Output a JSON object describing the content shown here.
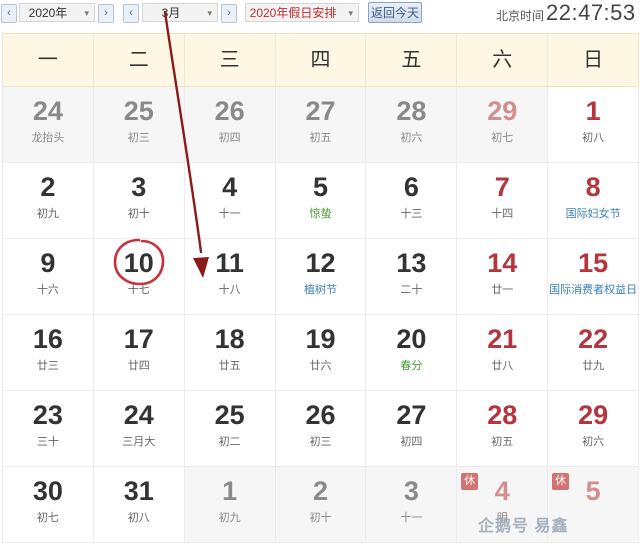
{
  "toolbar": {
    "year_value": "2020年",
    "month_value": "3月",
    "holiday_value": "2020年假日安排",
    "today_label": "返回今天",
    "clock_label": "北京时间",
    "clock_time": "22:47:53",
    "prev_glyph": "‹",
    "next_glyph": "›",
    "caret_glyph": "▾"
  },
  "weekdays": [
    "一",
    "二",
    "三",
    "四",
    "五",
    "六",
    "日"
  ],
  "rest_label": "休",
  "weeks": [
    [
      {
        "num": "24",
        "sub": "龙抬头",
        "other": true,
        "weekend": false,
        "style": "festival-red"
      },
      {
        "num": "25",
        "sub": "初三",
        "other": true,
        "weekend": false,
        "style": ""
      },
      {
        "num": "26",
        "sub": "初四",
        "other": true,
        "weekend": false,
        "style": ""
      },
      {
        "num": "27",
        "sub": "初五",
        "other": true,
        "weekend": false,
        "style": ""
      },
      {
        "num": "28",
        "sub": "初六",
        "other": true,
        "weekend": false,
        "style": ""
      },
      {
        "num": "29",
        "sub": "初七",
        "other": true,
        "weekend": true,
        "style": ""
      },
      {
        "num": "1",
        "sub": "初八",
        "other": false,
        "weekend": true,
        "style": ""
      }
    ],
    [
      {
        "num": "2",
        "sub": "初九",
        "other": false,
        "weekend": false,
        "style": ""
      },
      {
        "num": "3",
        "sub": "初十",
        "other": false,
        "weekend": false,
        "style": ""
      },
      {
        "num": "4",
        "sub": "十一",
        "other": false,
        "weekend": false,
        "style": ""
      },
      {
        "num": "5",
        "sub": "惊蛰",
        "other": false,
        "weekend": false,
        "style": "festival-green"
      },
      {
        "num": "6",
        "sub": "十三",
        "other": false,
        "weekend": false,
        "style": ""
      },
      {
        "num": "7",
        "sub": "十四",
        "other": false,
        "weekend": true,
        "style": ""
      },
      {
        "num": "8",
        "sub": "国际妇女节",
        "other": false,
        "weekend": true,
        "style": "festival-blue"
      }
    ],
    [
      {
        "num": "9",
        "sub": "十六",
        "other": false,
        "weekend": false,
        "style": ""
      },
      {
        "num": "10",
        "sub": "十七",
        "other": false,
        "weekend": false,
        "style": ""
      },
      {
        "num": "11",
        "sub": "十八",
        "other": false,
        "weekend": false,
        "style": ""
      },
      {
        "num": "12",
        "sub": "植树节",
        "other": false,
        "weekend": false,
        "style": "festival-blue"
      },
      {
        "num": "13",
        "sub": "二十",
        "other": false,
        "weekend": false,
        "style": ""
      },
      {
        "num": "14",
        "sub": "廿一",
        "other": false,
        "weekend": true,
        "style": ""
      },
      {
        "num": "15",
        "sub": "国际消费者权益日",
        "other": false,
        "weekend": true,
        "style": "festival-blue"
      }
    ],
    [
      {
        "num": "16",
        "sub": "廿三",
        "other": false,
        "weekend": false,
        "style": ""
      },
      {
        "num": "17",
        "sub": "廿四",
        "other": false,
        "weekend": false,
        "style": ""
      },
      {
        "num": "18",
        "sub": "廿五",
        "other": false,
        "weekend": false,
        "style": ""
      },
      {
        "num": "19",
        "sub": "廿六",
        "other": false,
        "weekend": false,
        "style": ""
      },
      {
        "num": "20",
        "sub": "春分",
        "other": false,
        "weekend": false,
        "style": "festival-green"
      },
      {
        "num": "21",
        "sub": "廿八",
        "other": false,
        "weekend": true,
        "style": ""
      },
      {
        "num": "22",
        "sub": "廿九",
        "other": false,
        "weekend": true,
        "style": ""
      }
    ],
    [
      {
        "num": "23",
        "sub": "三十",
        "other": false,
        "weekend": false,
        "style": ""
      },
      {
        "num": "24",
        "sub": "三月大",
        "other": false,
        "weekend": false,
        "style": ""
      },
      {
        "num": "25",
        "sub": "初二",
        "other": false,
        "weekend": false,
        "style": ""
      },
      {
        "num": "26",
        "sub": "初三",
        "other": false,
        "weekend": false,
        "style": ""
      },
      {
        "num": "27",
        "sub": "初四",
        "other": false,
        "weekend": false,
        "style": ""
      },
      {
        "num": "28",
        "sub": "初五",
        "other": false,
        "weekend": true,
        "style": ""
      },
      {
        "num": "29",
        "sub": "初六",
        "other": false,
        "weekend": true,
        "style": ""
      }
    ],
    [
      {
        "num": "30",
        "sub": "初七",
        "other": false,
        "weekend": false,
        "style": ""
      },
      {
        "num": "31",
        "sub": "初八",
        "other": false,
        "weekend": false,
        "style": ""
      },
      {
        "num": "1",
        "sub": "初九",
        "other": true,
        "weekend": false,
        "style": ""
      },
      {
        "num": "2",
        "sub": "初十",
        "other": true,
        "weekend": false,
        "style": ""
      },
      {
        "num": "3",
        "sub": "十一",
        "other": true,
        "weekend": false,
        "style": ""
      },
      {
        "num": "4",
        "sub": "明",
        "other": true,
        "weekend": true,
        "style": "",
        "rest": true
      },
      {
        "num": "5",
        "sub": "",
        "other": true,
        "weekend": true,
        "style": "",
        "rest": true
      }
    ]
  ],
  "annotation": {
    "circled_date": "10",
    "arrow_color": "#8b1a1a",
    "circle_color": "#c8323c"
  },
  "watermark": {
    "text": "企鹅号 易鑫"
  }
}
